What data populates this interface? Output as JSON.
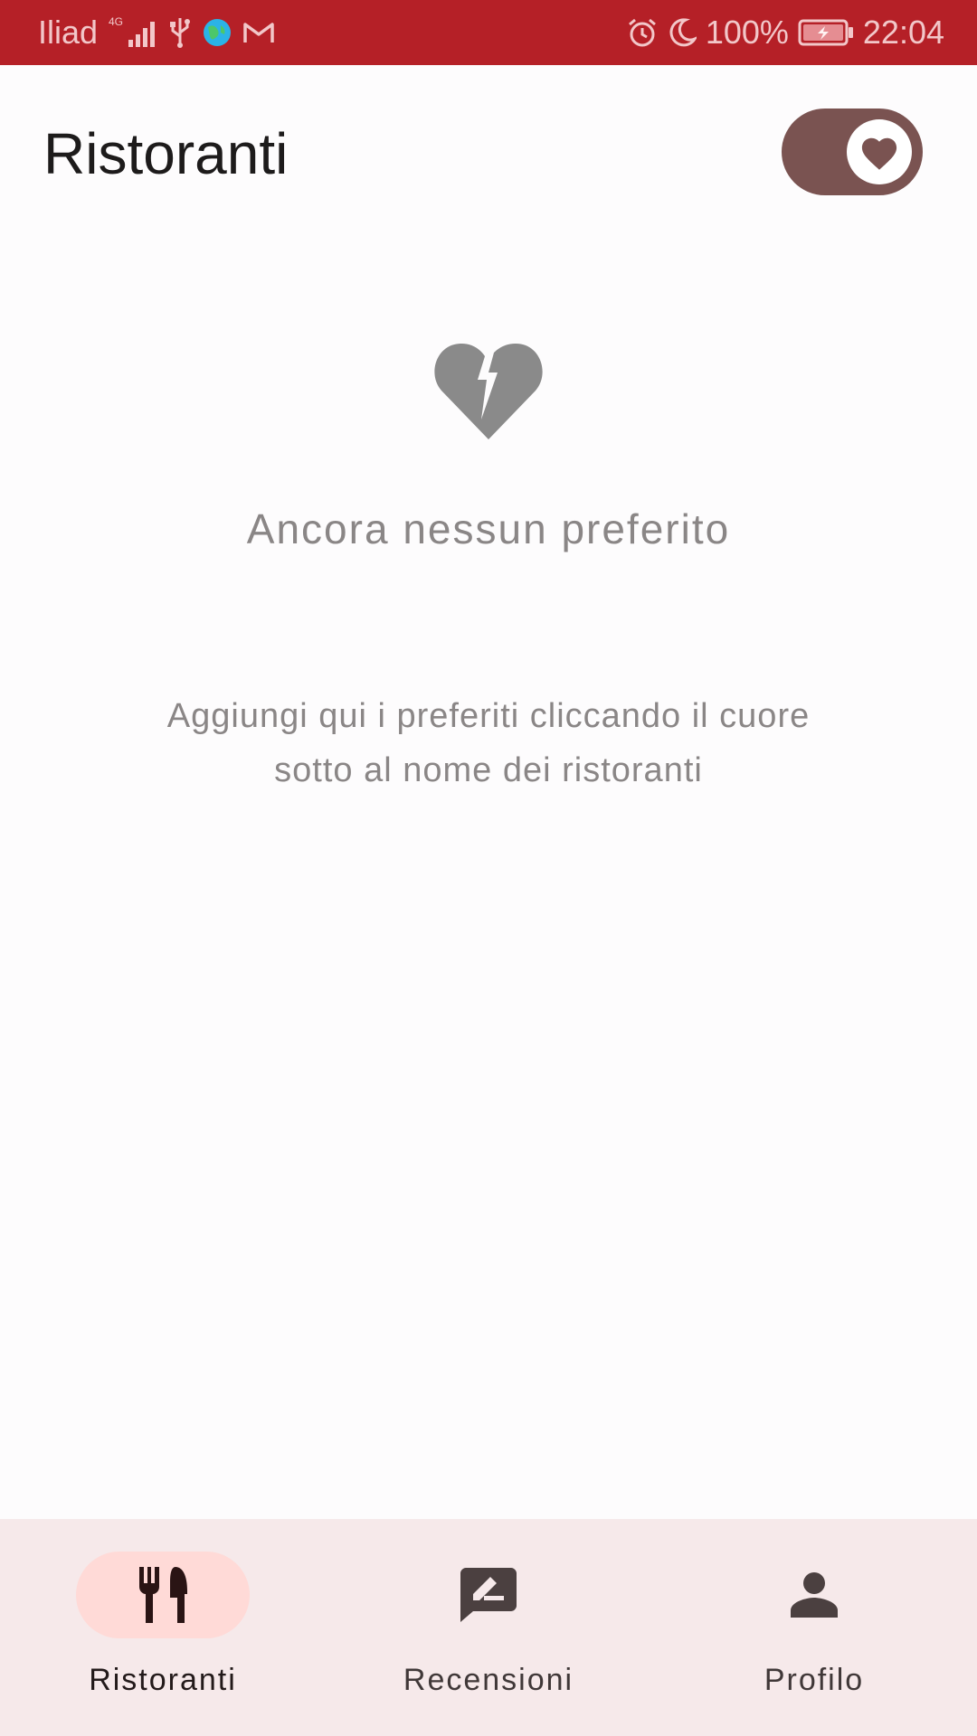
{
  "status_bar": {
    "carrier": "Iliad",
    "network": "4G",
    "battery": "100%",
    "time": "22:04",
    "icons": [
      "signal-icon",
      "usb-icon",
      "globe-app-icon",
      "gmail-icon",
      "alarm-icon",
      "do-not-disturb-moon-icon",
      "battery-charging-icon"
    ]
  },
  "header": {
    "title": "Ristoranti",
    "favorites_toggle": {
      "icon": "heart-icon",
      "on": true
    }
  },
  "empty_state": {
    "icon": "heart-broken-icon",
    "title": "Ancora nessun preferito",
    "message": "Aggiungi qui i preferiti cliccando il cuore sotto al nome dei ristoranti"
  },
  "bottom_nav": {
    "items": [
      {
        "label": "Ristoranti",
        "icon": "restaurant-icon",
        "active": true
      },
      {
        "label": "Recensioni",
        "icon": "rate-review-icon",
        "active": false
      },
      {
        "label": "Profilo",
        "icon": "person-icon",
        "active": false
      }
    ]
  },
  "colors": {
    "status_bar": "#b52027",
    "toggle": "#7a5351",
    "nav_background": "#f6e9ea",
    "nav_active_pill": "#ffdad7",
    "muted_text": "#8a8686"
  }
}
